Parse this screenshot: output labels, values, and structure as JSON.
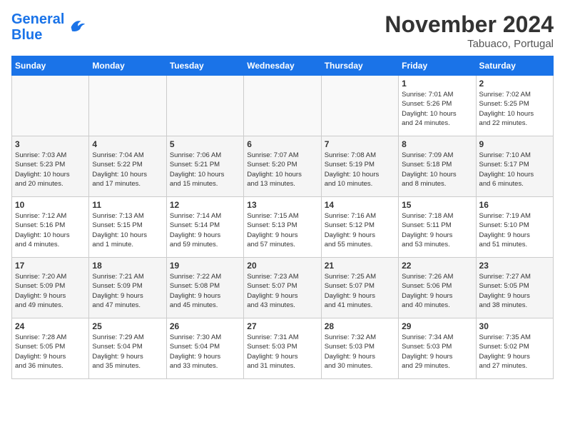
{
  "header": {
    "logo_line1": "General",
    "logo_line2": "Blue",
    "month": "November 2024",
    "location": "Tabuaco, Portugal"
  },
  "days_of_week": [
    "Sunday",
    "Monday",
    "Tuesday",
    "Wednesday",
    "Thursday",
    "Friday",
    "Saturday"
  ],
  "weeks": [
    [
      {
        "day": "",
        "info": ""
      },
      {
        "day": "",
        "info": ""
      },
      {
        "day": "",
        "info": ""
      },
      {
        "day": "",
        "info": ""
      },
      {
        "day": "",
        "info": ""
      },
      {
        "day": "1",
        "info": "Sunrise: 7:01 AM\nSunset: 5:26 PM\nDaylight: 10 hours\nand 24 minutes."
      },
      {
        "day": "2",
        "info": "Sunrise: 7:02 AM\nSunset: 5:25 PM\nDaylight: 10 hours\nand 22 minutes."
      }
    ],
    [
      {
        "day": "3",
        "info": "Sunrise: 7:03 AM\nSunset: 5:23 PM\nDaylight: 10 hours\nand 20 minutes."
      },
      {
        "day": "4",
        "info": "Sunrise: 7:04 AM\nSunset: 5:22 PM\nDaylight: 10 hours\nand 17 minutes."
      },
      {
        "day": "5",
        "info": "Sunrise: 7:06 AM\nSunset: 5:21 PM\nDaylight: 10 hours\nand 15 minutes."
      },
      {
        "day": "6",
        "info": "Sunrise: 7:07 AM\nSunset: 5:20 PM\nDaylight: 10 hours\nand 13 minutes."
      },
      {
        "day": "7",
        "info": "Sunrise: 7:08 AM\nSunset: 5:19 PM\nDaylight: 10 hours\nand 10 minutes."
      },
      {
        "day": "8",
        "info": "Sunrise: 7:09 AM\nSunset: 5:18 PM\nDaylight: 10 hours\nand 8 minutes."
      },
      {
        "day": "9",
        "info": "Sunrise: 7:10 AM\nSunset: 5:17 PM\nDaylight: 10 hours\nand 6 minutes."
      }
    ],
    [
      {
        "day": "10",
        "info": "Sunrise: 7:12 AM\nSunset: 5:16 PM\nDaylight: 10 hours\nand 4 minutes."
      },
      {
        "day": "11",
        "info": "Sunrise: 7:13 AM\nSunset: 5:15 PM\nDaylight: 10 hours\nand 1 minute."
      },
      {
        "day": "12",
        "info": "Sunrise: 7:14 AM\nSunset: 5:14 PM\nDaylight: 9 hours\nand 59 minutes."
      },
      {
        "day": "13",
        "info": "Sunrise: 7:15 AM\nSunset: 5:13 PM\nDaylight: 9 hours\nand 57 minutes."
      },
      {
        "day": "14",
        "info": "Sunrise: 7:16 AM\nSunset: 5:12 PM\nDaylight: 9 hours\nand 55 minutes."
      },
      {
        "day": "15",
        "info": "Sunrise: 7:18 AM\nSunset: 5:11 PM\nDaylight: 9 hours\nand 53 minutes."
      },
      {
        "day": "16",
        "info": "Sunrise: 7:19 AM\nSunset: 5:10 PM\nDaylight: 9 hours\nand 51 minutes."
      }
    ],
    [
      {
        "day": "17",
        "info": "Sunrise: 7:20 AM\nSunset: 5:09 PM\nDaylight: 9 hours\nand 49 minutes."
      },
      {
        "day": "18",
        "info": "Sunrise: 7:21 AM\nSunset: 5:09 PM\nDaylight: 9 hours\nand 47 minutes."
      },
      {
        "day": "19",
        "info": "Sunrise: 7:22 AM\nSunset: 5:08 PM\nDaylight: 9 hours\nand 45 minutes."
      },
      {
        "day": "20",
        "info": "Sunrise: 7:23 AM\nSunset: 5:07 PM\nDaylight: 9 hours\nand 43 minutes."
      },
      {
        "day": "21",
        "info": "Sunrise: 7:25 AM\nSunset: 5:07 PM\nDaylight: 9 hours\nand 41 minutes."
      },
      {
        "day": "22",
        "info": "Sunrise: 7:26 AM\nSunset: 5:06 PM\nDaylight: 9 hours\nand 40 minutes."
      },
      {
        "day": "23",
        "info": "Sunrise: 7:27 AM\nSunset: 5:05 PM\nDaylight: 9 hours\nand 38 minutes."
      }
    ],
    [
      {
        "day": "24",
        "info": "Sunrise: 7:28 AM\nSunset: 5:05 PM\nDaylight: 9 hours\nand 36 minutes."
      },
      {
        "day": "25",
        "info": "Sunrise: 7:29 AM\nSunset: 5:04 PM\nDaylight: 9 hours\nand 35 minutes."
      },
      {
        "day": "26",
        "info": "Sunrise: 7:30 AM\nSunset: 5:04 PM\nDaylight: 9 hours\nand 33 minutes."
      },
      {
        "day": "27",
        "info": "Sunrise: 7:31 AM\nSunset: 5:03 PM\nDaylight: 9 hours\nand 31 minutes."
      },
      {
        "day": "28",
        "info": "Sunrise: 7:32 AM\nSunset: 5:03 PM\nDaylight: 9 hours\nand 30 minutes."
      },
      {
        "day": "29",
        "info": "Sunrise: 7:34 AM\nSunset: 5:03 PM\nDaylight: 9 hours\nand 29 minutes."
      },
      {
        "day": "30",
        "info": "Sunrise: 7:35 AM\nSunset: 5:02 PM\nDaylight: 9 hours\nand 27 minutes."
      }
    ]
  ]
}
